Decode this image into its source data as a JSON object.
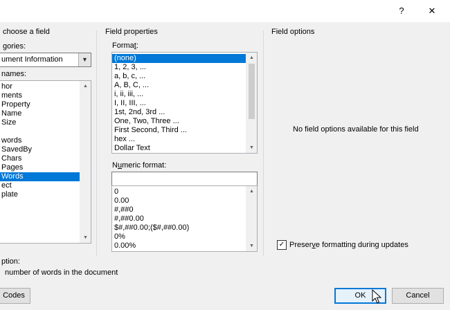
{
  "titlebar": {
    "help": "?",
    "close": "✕"
  },
  "left": {
    "title": "choose a field",
    "categories_label_pre": "",
    "categories_label_key": "",
    "categories_label_post": "gories:",
    "categories_value": "ument Information",
    "names_label": "names:",
    "field_names": [
      "hor",
      "ments",
      "Property",
      "Name",
      "Size",
      "",
      "words",
      "SavedBy",
      "Chars",
      "Pages",
      "Words",
      "ect",
      "plate"
    ],
    "selected_index": 10,
    "description_label": "ption:",
    "description_text": "number of words in the document",
    "field_codes_button": "Codes"
  },
  "middle": {
    "title": "Field properties",
    "format_label_pre": "Forma",
    "format_label_key": "t",
    "format_label_post": ":",
    "format_items": [
      "(none)",
      "1, 2, 3, ...",
      "a, b, c, ...",
      "A, B, C, ...",
      "i, ii, iii, ...",
      "I, II, III, ...",
      "1st, 2nd, 3rd ...",
      "One, Two, Three ...",
      "First Second, Third ...",
      "hex ...",
      "Dollar Text"
    ],
    "format_selected": 0,
    "numeric_label_pre": "N",
    "numeric_label_key": "u",
    "numeric_label_post": "meric format:",
    "numeric_value": "",
    "numeric_items": [
      "0",
      "0.00",
      "#,##0",
      "#,##0.00",
      "$#,##0.00;($#,##0.00)",
      "0%",
      "0.00%"
    ]
  },
  "right": {
    "title": "Field options",
    "no_options": "No field options available for this field",
    "preserve_pre": "Preser",
    "preserve_key": "v",
    "preserve_post": "e formatting during updates",
    "preserve_checked": "✓"
  },
  "buttons": {
    "ok": "OK",
    "cancel": "Cancel"
  }
}
